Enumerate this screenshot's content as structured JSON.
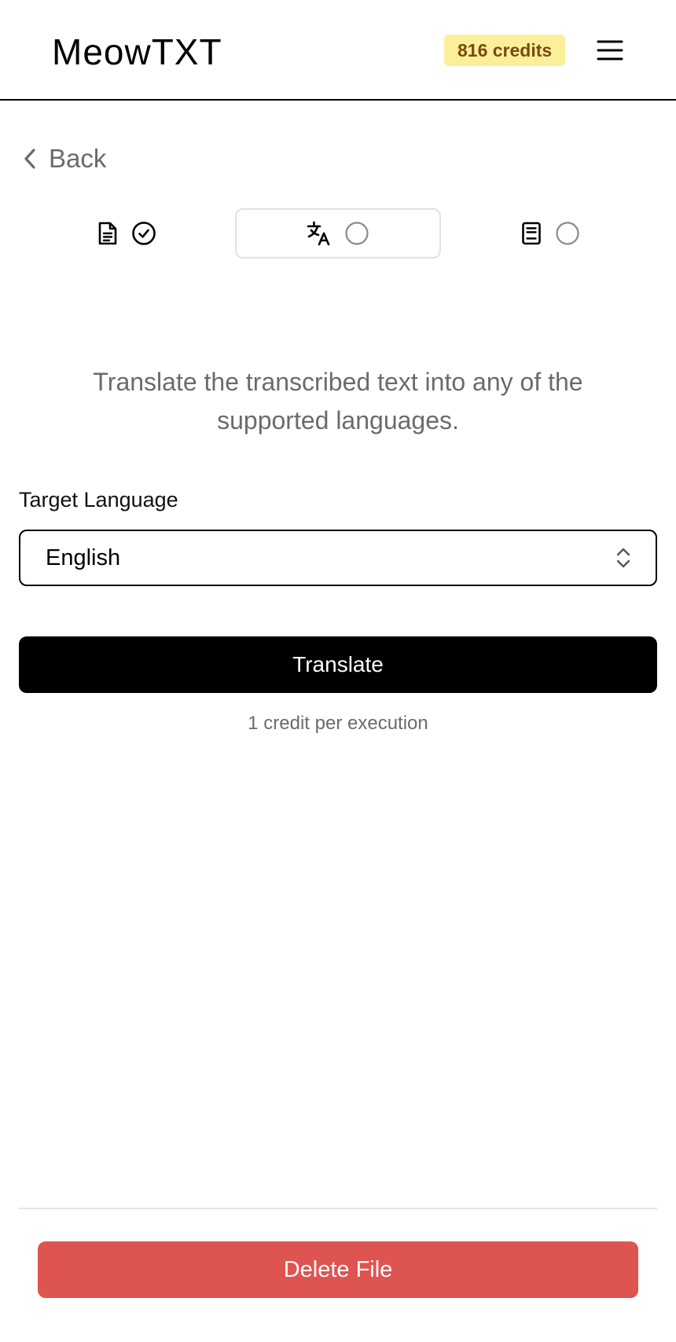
{
  "header": {
    "logo": "MeowTXT",
    "credits_badge": "816 credits",
    "menu_icon": "hamburger-menu-icon"
  },
  "nav": {
    "back_label": "Back",
    "back_icon": "chevron-left-icon"
  },
  "steps": [
    {
      "icon": "document-icon",
      "status": "completed",
      "status_icon": "check-circle-icon"
    },
    {
      "icon": "translate-icon",
      "status": "pending",
      "status_icon": "empty-circle-icon",
      "active": true
    },
    {
      "icon": "book-icon",
      "status": "pending",
      "status_icon": "empty-circle-icon"
    }
  ],
  "main": {
    "description": "Translate the transcribed text into any of the supported languages.",
    "target_language": {
      "label": "Target Language",
      "value": "English",
      "icon": "chevron-up-down-icon"
    },
    "translate_button": "Translate",
    "credit_note": "1 credit per execution"
  },
  "footer": {
    "delete_button": "Delete File"
  },
  "colors": {
    "badge_background": "#fcef99",
    "badge_text": "#7a4a12",
    "primary_button": "#000000",
    "danger_button": "#de5450",
    "muted_text": "#6b6b6b"
  }
}
